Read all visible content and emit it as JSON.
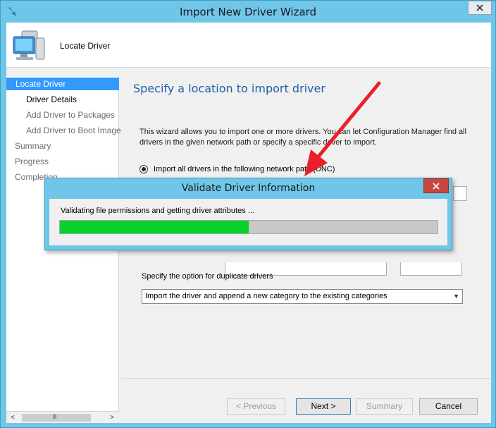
{
  "window": {
    "title": "Import New Driver Wizard",
    "close_label": "✕"
  },
  "header": {
    "title": "Locate Driver"
  },
  "nav": {
    "items": [
      {
        "label": "Locate Driver"
      },
      {
        "label": "Driver Details"
      },
      {
        "label": "Add Driver to Packages"
      },
      {
        "label": "Add Driver to Boot Image"
      },
      {
        "label": "Summary"
      },
      {
        "label": "Progress"
      },
      {
        "label": "Completion"
      }
    ],
    "scroll_grip": "III",
    "scroll_left": "<",
    "scroll_right": ">"
  },
  "content": {
    "heading": "Specify a location to import driver",
    "description": "This wizard allows you to import one or more drivers. You can let Configuration Manager find all drivers in the given network path or specify a specific driver to import.",
    "radio_label": "Import all drivers in the following network path (UNC)",
    "duplicate_label": "Specify the option for duplicate drivers",
    "duplicate_option": "Import the driver and append a new category to the existing categories"
  },
  "buttons": {
    "previous": "< Previous",
    "next": "Next >",
    "summary": "Summary",
    "cancel": "Cancel"
  },
  "dialog": {
    "title": "Validate Driver Information",
    "close_label": "✕",
    "status": "Validating file permissions and getting driver attributes ...",
    "progress": 0.5
  },
  "colors": {
    "titlebar": "#6fc6e8",
    "nav_selected": "#3399ff",
    "progress_fill": "#06d22a",
    "annotation_arrow": "#e8202a"
  }
}
